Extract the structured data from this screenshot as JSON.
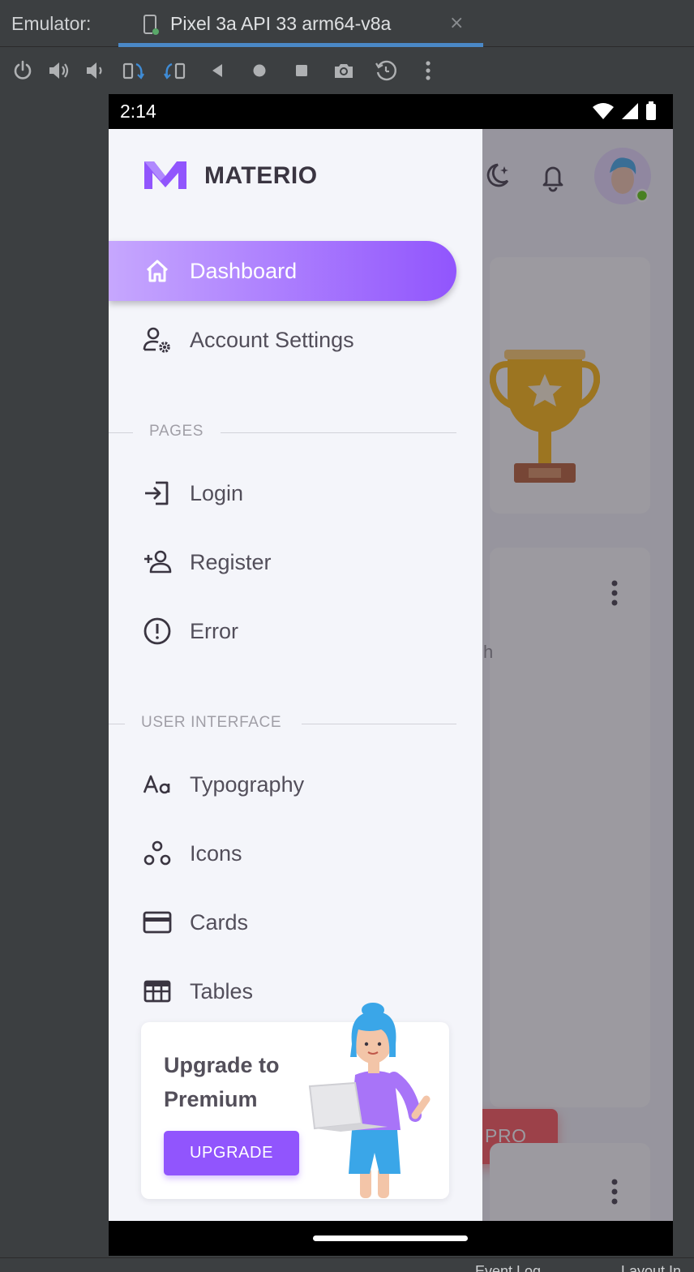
{
  "emulator": {
    "label": "Emulator:",
    "tab_title": "Pixel 3a API 33 arm64-v8a",
    "close_glyph": "×",
    "toolbar_icons": [
      "power-icon",
      "volume-up-icon",
      "volume-down-icon",
      "rotate-left-icon",
      "rotate-right-icon",
      "back-icon",
      "home-icon",
      "overview-icon",
      "screenshot-icon",
      "snapshot-icon",
      "more-icon"
    ],
    "bottom_status": [
      "Event Log",
      "Layout In"
    ]
  },
  "phone": {
    "time": "2:14",
    "status_icons": [
      "wifi-icon",
      "signal-icon",
      "battery-icon"
    ]
  },
  "drawer": {
    "brand": "MATERIO",
    "items": [
      {
        "label": "Dashboard",
        "icon": "home-icon",
        "active": true
      },
      {
        "label": "Account Settings",
        "icon": "account-cog-icon",
        "active": false
      }
    ],
    "sections": [
      {
        "title": "PAGES",
        "items": [
          {
            "label": "Login",
            "icon": "login-icon"
          },
          {
            "label": "Register",
            "icon": "account-plus-icon"
          },
          {
            "label": "Error",
            "icon": "alert-circle-icon"
          }
        ]
      },
      {
        "title": "USER INTERFACE",
        "items": [
          {
            "label": "Typography",
            "icon": "typography-icon"
          },
          {
            "label": "Icons",
            "icon": "shapes-icon"
          },
          {
            "label": "Cards",
            "icon": "credit-card-icon"
          },
          {
            "label": "Tables",
            "icon": "table-icon"
          }
        ]
      }
    ],
    "upgrade": {
      "title": "Upgrade to Premium",
      "button": "UPGRADE"
    }
  },
  "background": {
    "pro_label": "PRO",
    "partial_text": "h"
  },
  "colors": {
    "primary": "#9155fd",
    "primary_light": "#c6a7fe",
    "drawer_bg": "#f4f5fa",
    "text": "#3a3541",
    "pro_button": "#ff4c51",
    "ide_bg": "#3c3f41",
    "ide_tab_underline": "#4a88c7"
  }
}
